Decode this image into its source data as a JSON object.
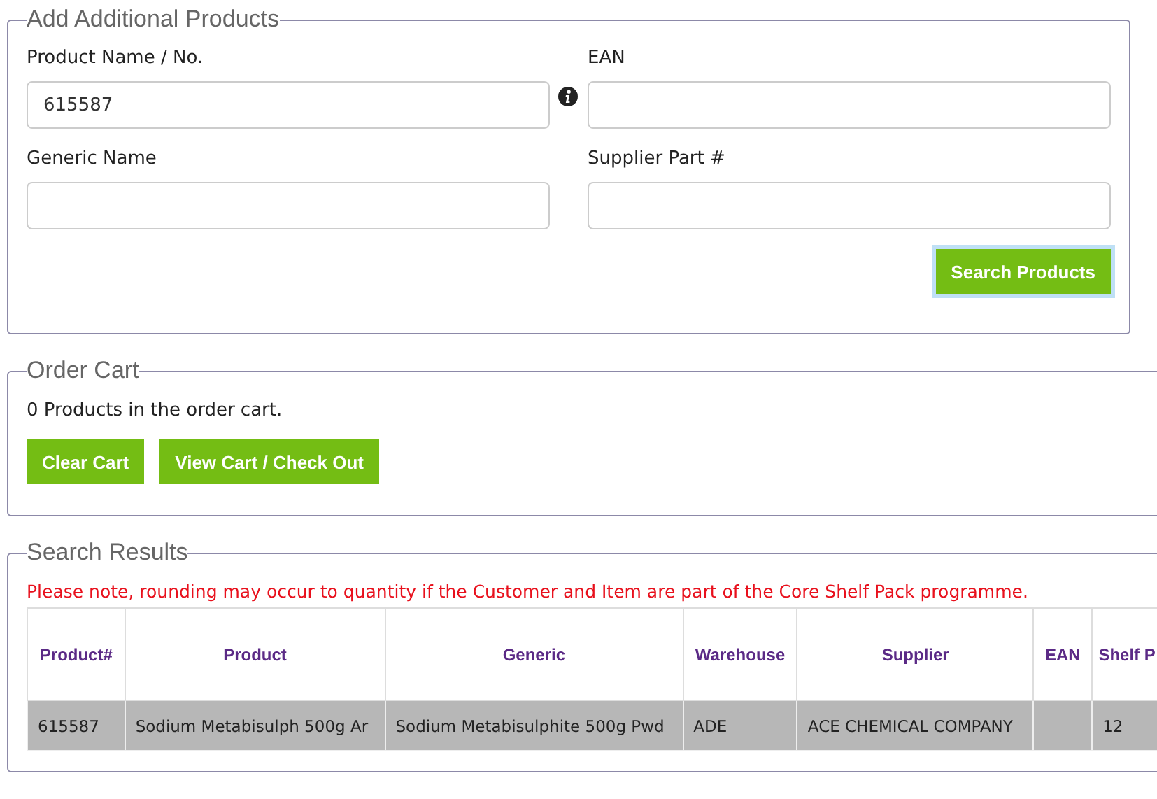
{
  "add_products": {
    "title": "Add Additional Products",
    "fields": [
      {
        "label": "Product Name / No.",
        "value": "615587",
        "info": true
      },
      {
        "label": "EAN",
        "info": false
      },
      {
        "label": "Generic Name",
        "info": false
      },
      {
        "label": "Supplier Part #",
        "info": false
      }
    ],
    "search_button": "Search Products"
  },
  "order_cart": {
    "title": "Order Cart",
    "summary": "0 Products in the order cart.",
    "buttons": [
      "Clear Cart",
      "View Cart / Check Out"
    ]
  },
  "search_results": {
    "title": "Search Results",
    "notice": "Please note, rounding may occur to quantity if the Customer and Item are part of the Core Shelf Pack programme.",
    "table": {
      "columns": [
        "Product#",
        "Product",
        "Generic",
        "Warehouse",
        "Supplier",
        "EAN",
        "Shelf P"
      ],
      "rows": [
        {
          "selected": true,
          "cells": [
            "615587",
            "Sodium Metabisulph 500g Ar",
            "Sodium Metabisulphite 500g Pwd",
            "ADE",
            "ACE CHEMICAL COMPANY",
            "",
            "12"
          ]
        }
      ]
    }
  }
}
